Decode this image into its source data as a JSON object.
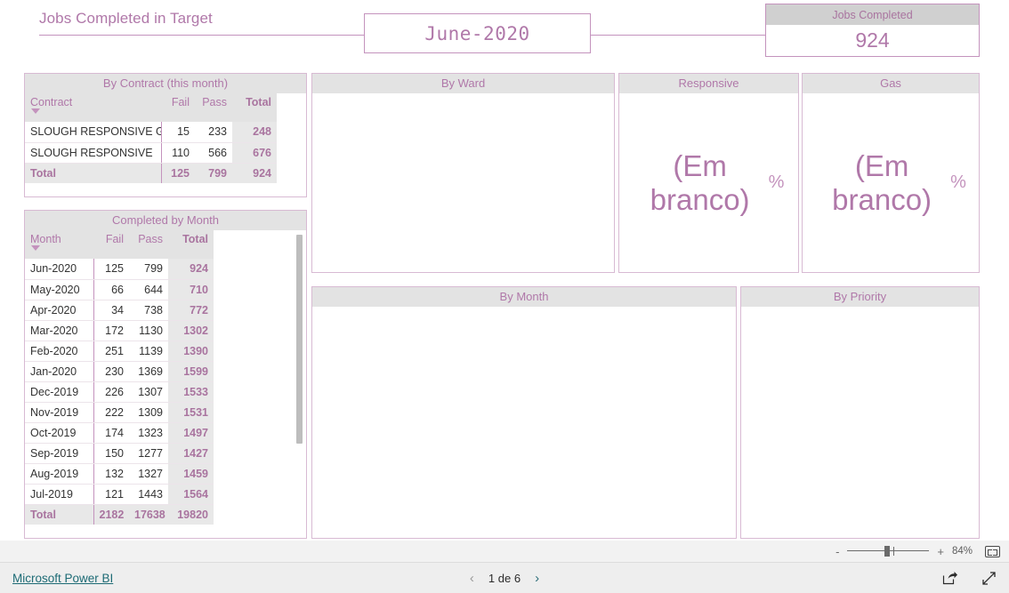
{
  "report": {
    "title": "Jobs Completed in Target",
    "slicer": {
      "name": "month-slicer",
      "value": "June-2020"
    },
    "kpi": {
      "label": "Jobs Completed",
      "value": "924"
    }
  },
  "panels": {
    "by_contract": {
      "title": "By Contract (this month)",
      "columns": [
        "Contract",
        "Fail",
        "Pass",
        "Total"
      ],
      "rows": [
        {
          "contract": "SLOUGH RESPONSIVE GAS",
          "fail": "15",
          "pass": "233",
          "total": "248"
        },
        {
          "contract": "SLOUGH RESPONSIVE",
          "fail": "110",
          "pass": "566",
          "total": "676"
        }
      ],
      "total_row": {
        "label": "Total",
        "fail": "125",
        "pass": "799",
        "total": "924"
      }
    },
    "completed_by_month": {
      "title": "Completed by Month",
      "columns": [
        "Month",
        "Fail",
        "Pass",
        "Total"
      ],
      "rows": [
        {
          "month": "Jun-2020",
          "fail": "125",
          "pass": "799",
          "total": "924"
        },
        {
          "month": "May-2020",
          "fail": "66",
          "pass": "644",
          "total": "710"
        },
        {
          "month": "Apr-2020",
          "fail": "34",
          "pass": "738",
          "total": "772"
        },
        {
          "month": "Mar-2020",
          "fail": "172",
          "pass": "1130",
          "total": "1302"
        },
        {
          "month": "Feb-2020",
          "fail": "251",
          "pass": "1139",
          "total": "1390"
        },
        {
          "month": "Jan-2020",
          "fail": "230",
          "pass": "1369",
          "total": "1599"
        },
        {
          "month": "Dec-2019",
          "fail": "226",
          "pass": "1307",
          "total": "1533"
        },
        {
          "month": "Nov-2019",
          "fail": "222",
          "pass": "1309",
          "total": "1531"
        },
        {
          "month": "Oct-2019",
          "fail": "174",
          "pass": "1323",
          "total": "1497"
        },
        {
          "month": "Sep-2019",
          "fail": "150",
          "pass": "1277",
          "total": "1427"
        },
        {
          "month": "Aug-2019",
          "fail": "132",
          "pass": "1327",
          "total": "1459"
        },
        {
          "month": "Jul-2019",
          "fail": "121",
          "pass": "1443",
          "total": "1564"
        }
      ],
      "total_row": {
        "label": "Total",
        "fail": "2182",
        "pass": "17638",
        "total": "19820"
      }
    },
    "by_ward": {
      "title": "By Ward"
    },
    "responsive": {
      "title": "Responsive",
      "value": "(Em branco)",
      "unit": "%"
    },
    "gas": {
      "title": "Gas",
      "value": "(Em branco)",
      "unit": "%"
    },
    "by_month": {
      "title": "By Month"
    },
    "by_priority": {
      "title": "By Priority"
    }
  },
  "zoom_bar": {
    "minus": "-",
    "plus": "+",
    "level": "84%",
    "fit_icon": "fit-to-page-icon"
  },
  "footer": {
    "brand_link": "Microsoft Power BI",
    "prev_icon": "chevron-left-icon",
    "next_icon": "chevron-right-icon",
    "page_label": "1 de 6",
    "share_icon": "share-icon",
    "fullscreen_icon": "fullscreen-icon"
  },
  "colors": {
    "accent": "#b078a9",
    "accent_border": "#c493bd",
    "panel_header": "#e3e3e3",
    "kpi_header": "#d0d0d0",
    "link": "#1d6b75"
  }
}
